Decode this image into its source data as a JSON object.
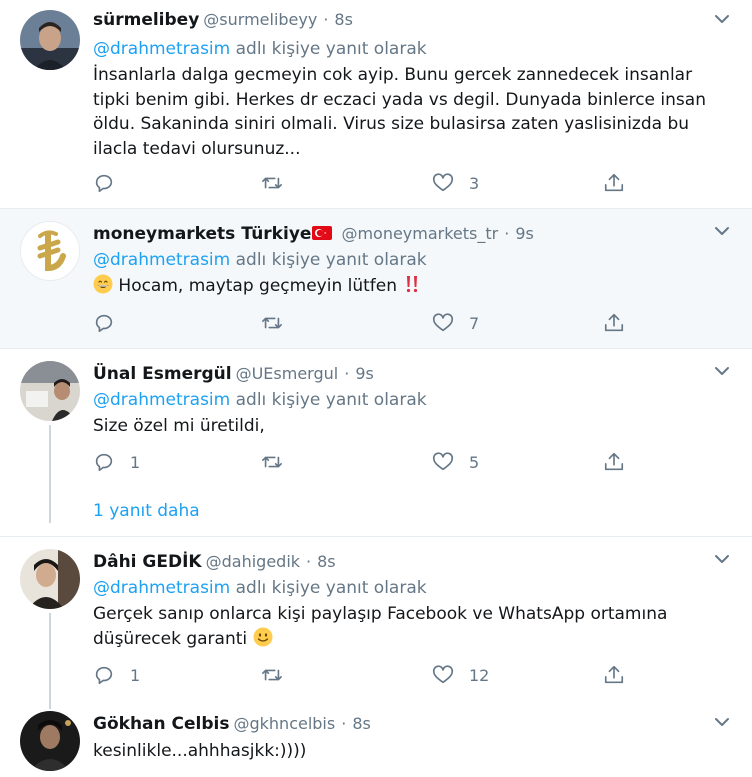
{
  "reply_prefix_suffix": "adlı kişiye yanıt olarak",
  "tweets": [
    {
      "name": "sürmelibey",
      "handle": "@surmelibeyy",
      "time": "8s",
      "reply_to": "@drahmetrasim",
      "text": "İnsanlarla dalga gecmeyin cok ayip. Bunu gercek zannedecek insanlar tipki benim gibi. Herkes dr eczaci yada vs degil. Dunyada binlerce insan öldu. Sakaninda siniri olmali. Virus size bulasirsa zaten yaslisinizda bu ilacla tedavi olursunuz...",
      "replies": "",
      "retweets": "",
      "likes": "3"
    },
    {
      "name": "moneymarkets Türkiye",
      "handle": "@moneymarkets_tr",
      "time": "9s",
      "reply_to": "@drahmetrasim",
      "text": "Hocam, maytap geçmeyin lütfen",
      "replies": "",
      "retweets": "",
      "likes": "7"
    },
    {
      "name": "Ünal Esmergül",
      "handle": "@UEsmergul",
      "time": "9s",
      "reply_to": "@drahmetrasim",
      "text": "Size özel mi üretildi,",
      "replies": "1",
      "retweets": "",
      "likes": "5"
    },
    {
      "name": "Dâhi GEDİK",
      "handle": "@dahigedik",
      "time": "8s",
      "reply_to": "@drahmetrasim",
      "text": "Gerçek sanıp onlarca kişi paylaşıp Facebook ve WhatsApp ortamına düşürecek garanti",
      "replies": "1",
      "retweets": "",
      "likes": "12"
    },
    {
      "name": "Gökhan Celbis",
      "handle": "@gkhncelbis",
      "time": "8s",
      "reply_to": "",
      "text": "kesinlikle...ahhhasjkk:))))",
      "replies": "",
      "retweets": "",
      "likes": ""
    }
  ],
  "more_replies": "1 yanıt daha",
  "colors": {
    "link": "#1da1f2",
    "secondary": "#657786",
    "border": "#e6ecf0",
    "shaded_bg": "#f5f8fa",
    "heart_double": "#dd2e44",
    "flag": "#e30a17"
  },
  "icons": {
    "reply": "reply-icon",
    "retweet": "retweet-icon",
    "like": "heart-icon",
    "share": "share-icon",
    "menu": "chevron-down-icon"
  }
}
